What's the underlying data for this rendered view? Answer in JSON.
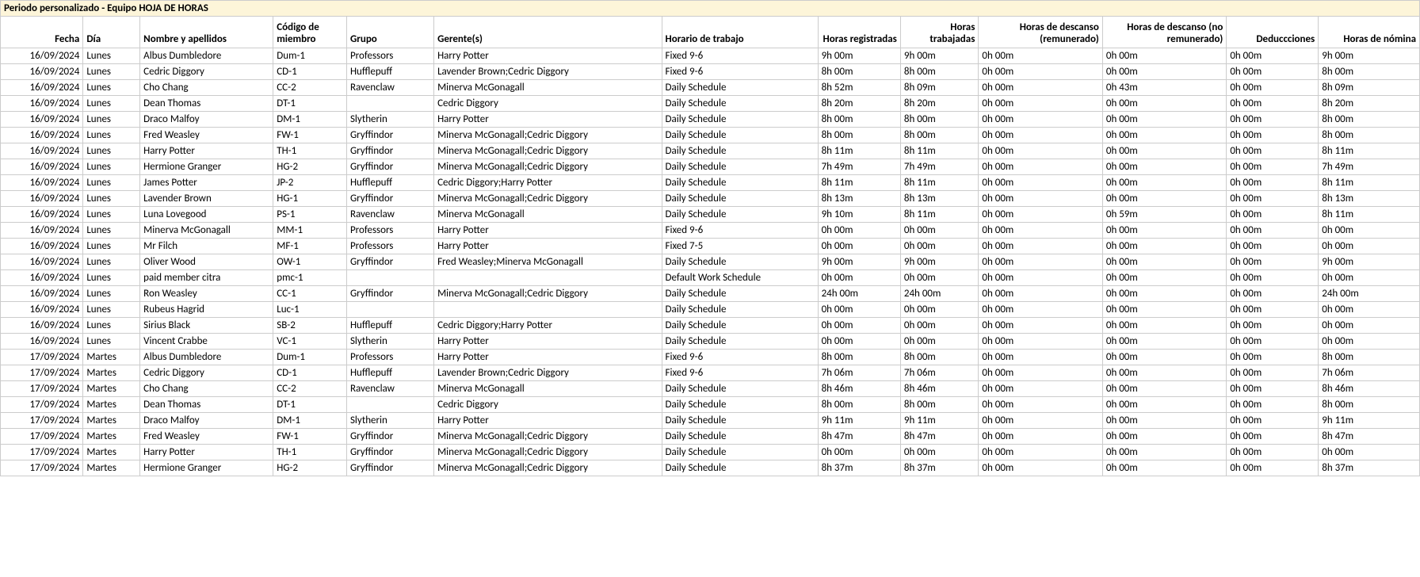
{
  "title": "Periodo personalizado - Equipo HOJA DE HORAS",
  "headers": {
    "fecha": "Fecha",
    "dia": "Día",
    "nombre": "Nombre y apellidos",
    "codigo": "Código de miembro",
    "grupo": "Grupo",
    "gerentes": "Gerente(s)",
    "horario": "Horario de trabajo",
    "h_reg": "Horas registradas",
    "h_trab": "Horas trabajadas",
    "h_desc_r": "Horas de descanso (remunerado)",
    "h_desc_nr": "Horas de descanso (no remunerado)",
    "deducc": "Deduccciones",
    "h_nom": "Horas de nómina"
  },
  "rows": [
    {
      "fecha": "16/09/2024",
      "dia": "Lunes",
      "nombre": "Albus Dumbledore",
      "codigo": "Dum-1",
      "grupo": "Professors",
      "gerentes": "Harry Potter",
      "horario": "Fixed 9-6",
      "h_reg": "9h 00m",
      "h_trab": "9h 00m",
      "h_desc_r": "0h 00m",
      "h_desc_nr": "0h 00m",
      "deducc": "0h 00m",
      "h_nom": "9h 00m"
    },
    {
      "fecha": "16/09/2024",
      "dia": "Lunes",
      "nombre": "Cedric Diggory",
      "codigo": "CD-1",
      "grupo": "Hufflepuff",
      "gerentes": "Lavender Brown;Cedric Diggory",
      "horario": "Fixed 9-6",
      "h_reg": "8h 00m",
      "h_trab": "8h 00m",
      "h_desc_r": "0h 00m",
      "h_desc_nr": "0h 00m",
      "deducc": "0h 00m",
      "h_nom": "8h 00m"
    },
    {
      "fecha": "16/09/2024",
      "dia": "Lunes",
      "nombre": "Cho Chang",
      "codigo": "CC-2",
      "grupo": "Ravenclaw",
      "gerentes": "Minerva McGonagall",
      "horario": "Daily Schedule",
      "h_reg": "8h 52m",
      "h_trab": "8h 09m",
      "h_desc_r": "0h 00m",
      "h_desc_nr": "0h 43m",
      "deducc": "0h 00m",
      "h_nom": "8h 09m"
    },
    {
      "fecha": "16/09/2024",
      "dia": "Lunes",
      "nombre": "Dean Thomas",
      "codigo": "DT-1",
      "grupo": "",
      "gerentes": "Cedric Diggory",
      "horario": "Daily Schedule",
      "h_reg": "8h 20m",
      "h_trab": "8h 20m",
      "h_desc_r": "0h 00m",
      "h_desc_nr": "0h 00m",
      "deducc": "0h 00m",
      "h_nom": "8h 20m"
    },
    {
      "fecha": "16/09/2024",
      "dia": "Lunes",
      "nombre": "Draco Malfoy",
      "codigo": "DM-1",
      "grupo": "Slytherin",
      "gerentes": "Harry Potter",
      "horario": "Daily Schedule",
      "h_reg": "8h 00m",
      "h_trab": "8h 00m",
      "h_desc_r": "0h 00m",
      "h_desc_nr": "0h 00m",
      "deducc": "0h 00m",
      "h_nom": "8h 00m"
    },
    {
      "fecha": "16/09/2024",
      "dia": "Lunes",
      "nombre": "Fred Weasley",
      "codigo": "FW-1",
      "grupo": "Gryffindor",
      "gerentes": "Minerva McGonagall;Cedric Diggory",
      "horario": "Daily Schedule",
      "h_reg": "8h 00m",
      "h_trab": "8h 00m",
      "h_desc_r": "0h 00m",
      "h_desc_nr": "0h 00m",
      "deducc": "0h 00m",
      "h_nom": "8h 00m"
    },
    {
      "fecha": "16/09/2024",
      "dia": "Lunes",
      "nombre": "Harry Potter",
      "codigo": "TH-1",
      "grupo": "Gryffindor",
      "gerentes": "Minerva McGonagall;Cedric Diggory",
      "horario": "Daily Schedule",
      "h_reg": "8h 11m",
      "h_trab": "8h 11m",
      "h_desc_r": "0h 00m",
      "h_desc_nr": "0h 00m",
      "deducc": "0h 00m",
      "h_nom": "8h 11m"
    },
    {
      "fecha": "16/09/2024",
      "dia": "Lunes",
      "nombre": "Hermione Granger",
      "codigo": "HG-2",
      "grupo": "Gryffindor",
      "gerentes": "Minerva McGonagall;Cedric Diggory",
      "horario": "Daily Schedule",
      "h_reg": "7h 49m",
      "h_trab": "7h 49m",
      "h_desc_r": "0h 00m",
      "h_desc_nr": "0h 00m",
      "deducc": "0h 00m",
      "h_nom": "7h 49m"
    },
    {
      "fecha": "16/09/2024",
      "dia": "Lunes",
      "nombre": "James Potter",
      "codigo": "JP-2",
      "grupo": "Hufflepuff",
      "gerentes": "Cedric Diggory;Harry Potter",
      "horario": "Daily Schedule",
      "h_reg": "8h 11m",
      "h_trab": "8h 11m",
      "h_desc_r": "0h 00m",
      "h_desc_nr": "0h 00m",
      "deducc": "0h 00m",
      "h_nom": "8h 11m"
    },
    {
      "fecha": "16/09/2024",
      "dia": "Lunes",
      "nombre": "Lavender Brown",
      "codigo": "HG-1",
      "grupo": "Gryffindor",
      "gerentes": "Minerva McGonagall;Cedric Diggory",
      "horario": "Daily Schedule",
      "h_reg": "8h 13m",
      "h_trab": "8h 13m",
      "h_desc_r": "0h 00m",
      "h_desc_nr": "0h 00m",
      "deducc": "0h 00m",
      "h_nom": "8h 13m"
    },
    {
      "fecha": "16/09/2024",
      "dia": "Lunes",
      "nombre": "Luna Lovegood",
      "codigo": "PS-1",
      "grupo": "Ravenclaw",
      "gerentes": "Minerva McGonagall",
      "horario": "Daily Schedule",
      "h_reg": "9h 10m",
      "h_trab": "8h 11m",
      "h_desc_r": "0h 00m",
      "h_desc_nr": "0h 59m",
      "deducc": "0h 00m",
      "h_nom": "8h 11m"
    },
    {
      "fecha": "16/09/2024",
      "dia": "Lunes",
      "nombre": "Minerva McGonagall",
      "codigo": "MM-1",
      "grupo": "Professors",
      "gerentes": "Harry Potter",
      "horario": "Fixed 9-6",
      "h_reg": "0h 00m",
      "h_trab": "0h 00m",
      "h_desc_r": "0h 00m",
      "h_desc_nr": "0h 00m",
      "deducc": "0h 00m",
      "h_nom": "0h 00m"
    },
    {
      "fecha": "16/09/2024",
      "dia": "Lunes",
      "nombre": "Mr Filch",
      "codigo": "MF-1",
      "grupo": "Professors",
      "gerentes": "Harry Potter",
      "horario": "Fixed 7-5",
      "h_reg": "0h 00m",
      "h_trab": "0h 00m",
      "h_desc_r": "0h 00m",
      "h_desc_nr": "0h 00m",
      "deducc": "0h 00m",
      "h_nom": "0h 00m"
    },
    {
      "fecha": "16/09/2024",
      "dia": "Lunes",
      "nombre": "Oliver Wood",
      "codigo": "OW-1",
      "grupo": "Gryffindor",
      "gerentes": "Fred Weasley;Minerva McGonagall",
      "horario": "Daily Schedule",
      "h_reg": "9h 00m",
      "h_trab": "9h 00m",
      "h_desc_r": "0h 00m",
      "h_desc_nr": "0h 00m",
      "deducc": "0h 00m",
      "h_nom": "9h 00m"
    },
    {
      "fecha": "16/09/2024",
      "dia": "Lunes",
      "nombre": "paid member citra",
      "codigo": "pmc-1",
      "grupo": "",
      "gerentes": "",
      "horario": "Default Work Schedule",
      "h_reg": "0h 00m",
      "h_trab": "0h 00m",
      "h_desc_r": "0h 00m",
      "h_desc_nr": "0h 00m",
      "deducc": "0h 00m",
      "h_nom": "0h 00m"
    },
    {
      "fecha": "16/09/2024",
      "dia": "Lunes",
      "nombre": "Ron Weasley",
      "codigo": "CC-1",
      "grupo": "Gryffindor",
      "gerentes": "Minerva McGonagall;Cedric Diggory",
      "horario": "Daily Schedule",
      "h_reg": "24h 00m",
      "h_trab": "24h 00m",
      "h_desc_r": "0h 00m",
      "h_desc_nr": "0h 00m",
      "deducc": "0h 00m",
      "h_nom": "24h 00m"
    },
    {
      "fecha": "16/09/2024",
      "dia": "Lunes",
      "nombre": "Rubeus Hagrid",
      "codigo": "Luc-1",
      "grupo": "",
      "gerentes": "",
      "horario": "Daily Schedule",
      "h_reg": "0h 00m",
      "h_trab": "0h 00m",
      "h_desc_r": "0h 00m",
      "h_desc_nr": "0h 00m",
      "deducc": "0h 00m",
      "h_nom": "0h 00m"
    },
    {
      "fecha": "16/09/2024",
      "dia": "Lunes",
      "nombre": "Sirius Black",
      "codigo": "SB-2",
      "grupo": "Hufflepuff",
      "gerentes": "Cedric Diggory;Harry Potter",
      "horario": "Daily Schedule",
      "h_reg": "0h 00m",
      "h_trab": "0h 00m",
      "h_desc_r": "0h 00m",
      "h_desc_nr": "0h 00m",
      "deducc": "0h 00m",
      "h_nom": "0h 00m"
    },
    {
      "fecha": "16/09/2024",
      "dia": "Lunes",
      "nombre": "Vincent Crabbe",
      "codigo": "VC-1",
      "grupo": "Slytherin",
      "gerentes": "Harry Potter",
      "horario": "Daily Schedule",
      "h_reg": "0h 00m",
      "h_trab": "0h 00m",
      "h_desc_r": "0h 00m",
      "h_desc_nr": "0h 00m",
      "deducc": "0h 00m",
      "h_nom": "0h 00m"
    },
    {
      "fecha": "17/09/2024",
      "dia": "Martes",
      "nombre": "Albus Dumbledore",
      "codigo": "Dum-1",
      "grupo": "Professors",
      "gerentes": "Harry Potter",
      "horario": "Fixed 9-6",
      "h_reg": "8h 00m",
      "h_trab": "8h 00m",
      "h_desc_r": "0h 00m",
      "h_desc_nr": "0h 00m",
      "deducc": "0h 00m",
      "h_nom": "8h 00m"
    },
    {
      "fecha": "17/09/2024",
      "dia": "Martes",
      "nombre": "Cedric Diggory",
      "codigo": "CD-1",
      "grupo": "Hufflepuff",
      "gerentes": "Lavender Brown;Cedric Diggory",
      "horario": "Fixed 9-6",
      "h_reg": "7h 06m",
      "h_trab": "7h 06m",
      "h_desc_r": "0h 00m",
      "h_desc_nr": "0h 00m",
      "deducc": "0h 00m",
      "h_nom": "7h 06m"
    },
    {
      "fecha": "17/09/2024",
      "dia": "Martes",
      "nombre": "Cho Chang",
      "codigo": "CC-2",
      "grupo": "Ravenclaw",
      "gerentes": "Minerva McGonagall",
      "horario": "Daily Schedule",
      "h_reg": "8h 46m",
      "h_trab": "8h 46m",
      "h_desc_r": "0h 00m",
      "h_desc_nr": "0h 00m",
      "deducc": "0h 00m",
      "h_nom": "8h 46m"
    },
    {
      "fecha": "17/09/2024",
      "dia": "Martes",
      "nombre": "Dean Thomas",
      "codigo": "DT-1",
      "grupo": "",
      "gerentes": "Cedric Diggory",
      "horario": "Daily Schedule",
      "h_reg": "8h 00m",
      "h_trab": "8h 00m",
      "h_desc_r": "0h 00m",
      "h_desc_nr": "0h 00m",
      "deducc": "0h 00m",
      "h_nom": "8h 00m"
    },
    {
      "fecha": "17/09/2024",
      "dia": "Martes",
      "nombre": "Draco Malfoy",
      "codigo": "DM-1",
      "grupo": "Slytherin",
      "gerentes": "Harry Potter",
      "horario": "Daily Schedule",
      "h_reg": "9h 11m",
      "h_trab": "9h 11m",
      "h_desc_r": "0h 00m",
      "h_desc_nr": "0h 00m",
      "deducc": "0h 00m",
      "h_nom": "9h 11m"
    },
    {
      "fecha": "17/09/2024",
      "dia": "Martes",
      "nombre": "Fred Weasley",
      "codigo": "FW-1",
      "grupo": "Gryffindor",
      "gerentes": "Minerva McGonagall;Cedric Diggory",
      "horario": "Daily Schedule",
      "h_reg": "8h 47m",
      "h_trab": "8h 47m",
      "h_desc_r": "0h 00m",
      "h_desc_nr": "0h 00m",
      "deducc": "0h 00m",
      "h_nom": "8h 47m"
    },
    {
      "fecha": "17/09/2024",
      "dia": "Martes",
      "nombre": "Harry Potter",
      "codigo": "TH-1",
      "grupo": "Gryffindor",
      "gerentes": "Minerva McGonagall;Cedric Diggory",
      "horario": "Daily Schedule",
      "h_reg": "0h 00m",
      "h_trab": "0h 00m",
      "h_desc_r": "0h 00m",
      "h_desc_nr": "0h 00m",
      "deducc": "0h 00m",
      "h_nom": "0h 00m"
    },
    {
      "fecha": "17/09/2024",
      "dia": "Martes",
      "nombre": "Hermione Granger",
      "codigo": "HG-2",
      "grupo": "Gryffindor",
      "gerentes": "Minerva McGonagall;Cedric Diggory",
      "horario": "Daily Schedule",
      "h_reg": "8h 37m",
      "h_trab": "8h 37m",
      "h_desc_r": "0h 00m",
      "h_desc_nr": "0h 00m",
      "deducc": "0h 00m",
      "h_nom": "8h 37m"
    }
  ]
}
